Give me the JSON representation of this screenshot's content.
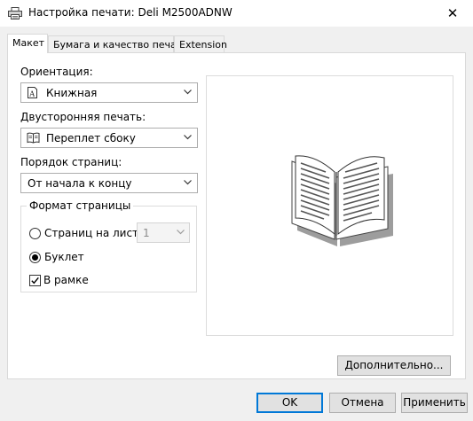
{
  "window": {
    "title": "Настройка печати: Deli M2500ADNW",
    "close_glyph": "✕",
    "icon": "printer-icon"
  },
  "tabs": [
    {
      "label": "Макет",
      "active": true
    },
    {
      "label": "Бумага и качество печати",
      "active": false
    },
    {
      "label": "Extension",
      "active": false
    }
  ],
  "layout": {
    "orientation": {
      "label": "Ориентация:",
      "value": "Книжная",
      "icon": "portrait-page-icon"
    },
    "duplex": {
      "label": "Двусторонняя печать:",
      "value": "Переплет сбоку",
      "icon": "booklet-side-binding-icon"
    },
    "page_order": {
      "label": "Порядок страниц:",
      "value": "От начала к концу"
    },
    "page_format": {
      "title": "Формат страницы",
      "pages_per_sheet": {
        "label": "Страниц на листе",
        "value": "1",
        "selected": false
      },
      "booklet": {
        "label": "Буклет",
        "selected": true
      },
      "border": {
        "label": "В рамке",
        "checked": true
      }
    },
    "preview_icon": "open-book-icon"
  },
  "buttons": {
    "advanced": "Дополнительно...",
    "ok": "OK",
    "cancel": "Отмена",
    "apply": "Применить"
  },
  "colors": {
    "accent": "#0078d7",
    "panel_bg": "#ffffff",
    "dialog_bg": "#f0f0f0"
  }
}
